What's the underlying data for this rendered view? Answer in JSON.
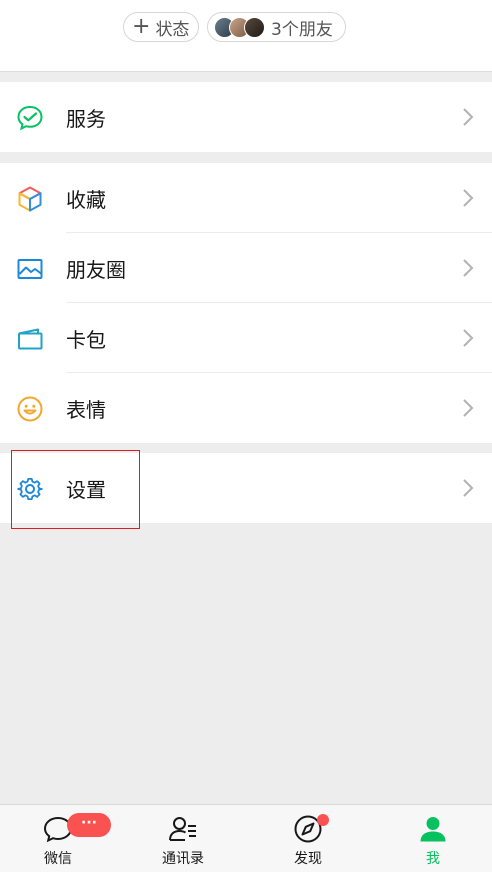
{
  "header": {
    "status_chip": {
      "plus": "+",
      "label": "状态"
    },
    "friends_chip": {
      "label": "3个朋友"
    }
  },
  "menu": {
    "service": {
      "label": "服务"
    },
    "favorites": {
      "label": "收藏"
    },
    "moments": {
      "label": "朋友圈"
    },
    "cards": {
      "label": "卡包"
    },
    "stickers": {
      "label": "表情"
    },
    "settings": {
      "label": "设置"
    }
  },
  "tabbar": {
    "chats": {
      "label": "微信",
      "badge": "···"
    },
    "contacts": {
      "label": "通讯录"
    },
    "discover": {
      "label": "发现"
    },
    "me": {
      "label": "我"
    }
  },
  "colors": {
    "accent_green": "#07c160",
    "badge_red": "#fa5151",
    "highlight_box": "#d81e1e",
    "icon_blue": "#1e88d8"
  },
  "icons": {
    "service": "wechat-pay-icon",
    "favorites": "cube-icon",
    "moments": "landscape-photo-icon",
    "cards": "card-wallet-icon",
    "stickers": "smiley-icon",
    "settings": "gear-icon",
    "chevron": "chevron-right-icon",
    "chats": "chat-bubble-icon",
    "contacts": "contacts-icon",
    "discover": "compass-icon",
    "me": "person-icon"
  }
}
